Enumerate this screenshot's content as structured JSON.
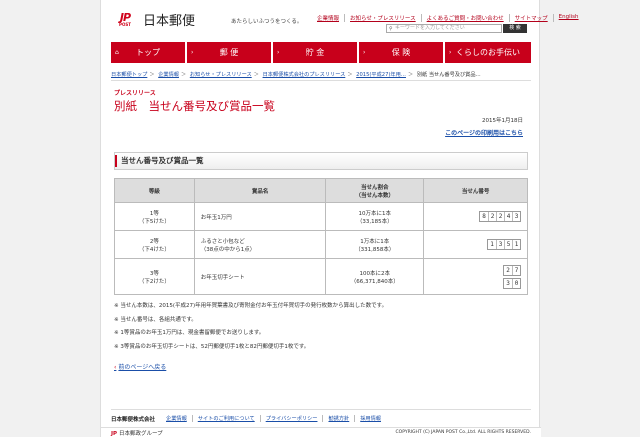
{
  "header": {
    "logo_mark": "JP",
    "logo_sub": "POST",
    "logo_text": "日本郵便",
    "tagline": "あたらしいふつうをつくる。",
    "top_links": [
      "企業情報",
      "お知らせ・プレスリリース",
      "よくあるご質問・お問い合わせ",
      "サイトマップ",
      "English"
    ],
    "search_placeholder": "キーワードを入力してください",
    "search_button": "検 索"
  },
  "nav": [
    {
      "label": "トップ",
      "icon": "home-icon"
    },
    {
      "label": "郵 便",
      "icon": "arrow-icon"
    },
    {
      "label": "貯 金",
      "icon": "arrow-icon"
    },
    {
      "label": "保 険",
      "icon": "arrow-icon"
    },
    {
      "label": "くらしのお手伝い",
      "icon": "arrow-icon"
    }
  ],
  "breadcrumb": {
    "items": [
      "日本郵便トップ",
      "企業情報",
      "お知らせ・プレスリリース",
      "日本郵便株式会社のプレスリリース",
      "2015(平成27)年用…"
    ],
    "current": "別紙 当せん番号及び賞品…"
  },
  "article": {
    "label": "プレスリリース",
    "title": "別紙　当せん番号及び賞品一覧",
    "date": "2015年1月18日",
    "print_link": "このページの印刷用はこちら",
    "section_title": "当せん番号及び賞品一覧"
  },
  "table": {
    "headers": [
      "等級",
      "賞品名",
      "当せん割合\n（当せん本数）",
      "当せん番号"
    ],
    "rows": [
      {
        "grade": "1等",
        "grade_sub": "（下5けた）",
        "prize": "お年玉1万円",
        "prize_sub": "",
        "ratio": "10万本に1本",
        "count": "（33,185本）",
        "numbers": [
          [
            "8",
            "2",
            "2",
            "4",
            "3"
          ]
        ]
      },
      {
        "grade": "2等",
        "grade_sub": "（下4けた）",
        "prize": "ふるさと小包など",
        "prize_sub": "（38点の中から1点）",
        "ratio": "1万本に1本",
        "count": "（331,858本）",
        "numbers": [
          [
            "1",
            "3",
            "5",
            "1"
          ]
        ]
      },
      {
        "grade": "3等",
        "grade_sub": "（下2けた）",
        "prize": "お年玉切手シート",
        "prize_sub": "",
        "ratio": "100本に2本",
        "count": "（66,371,840本）",
        "numbers": [
          [
            "2",
            "7"
          ],
          [
            "3",
            "0"
          ]
        ]
      }
    ]
  },
  "notes": [
    "※ 当せん本数は、2015(平成27)年用年賀葉書及び寄附金付お年玉付年賀切手の発行枚数から算出した数です。",
    "※ 当せん番号は、各組共通です。",
    "※ 1等賞品のお年玉1万円は、現金書留郵便でお送りします。",
    "※ 3等賞品のお年玉切手シートは、52円郵便切手1枚と82円郵便切手1枚です。"
  ],
  "back_link": "前のページへ戻る",
  "footer": {
    "company": "日本郵便株式会社",
    "links": [
      "企業情報",
      "サイトのご利用について",
      "プライバシーポリシー",
      "勧誘方針",
      "採用情報"
    ],
    "group_logo": "JP",
    "group_text": "日本郵政グループ",
    "copyright": "COPYRIGHT (C) JAPAN POST Co.,Ltd. ALL RIGHTS RESERVED."
  },
  "colors": {
    "brand": "#c8001b",
    "link": "#1a4ea8"
  }
}
